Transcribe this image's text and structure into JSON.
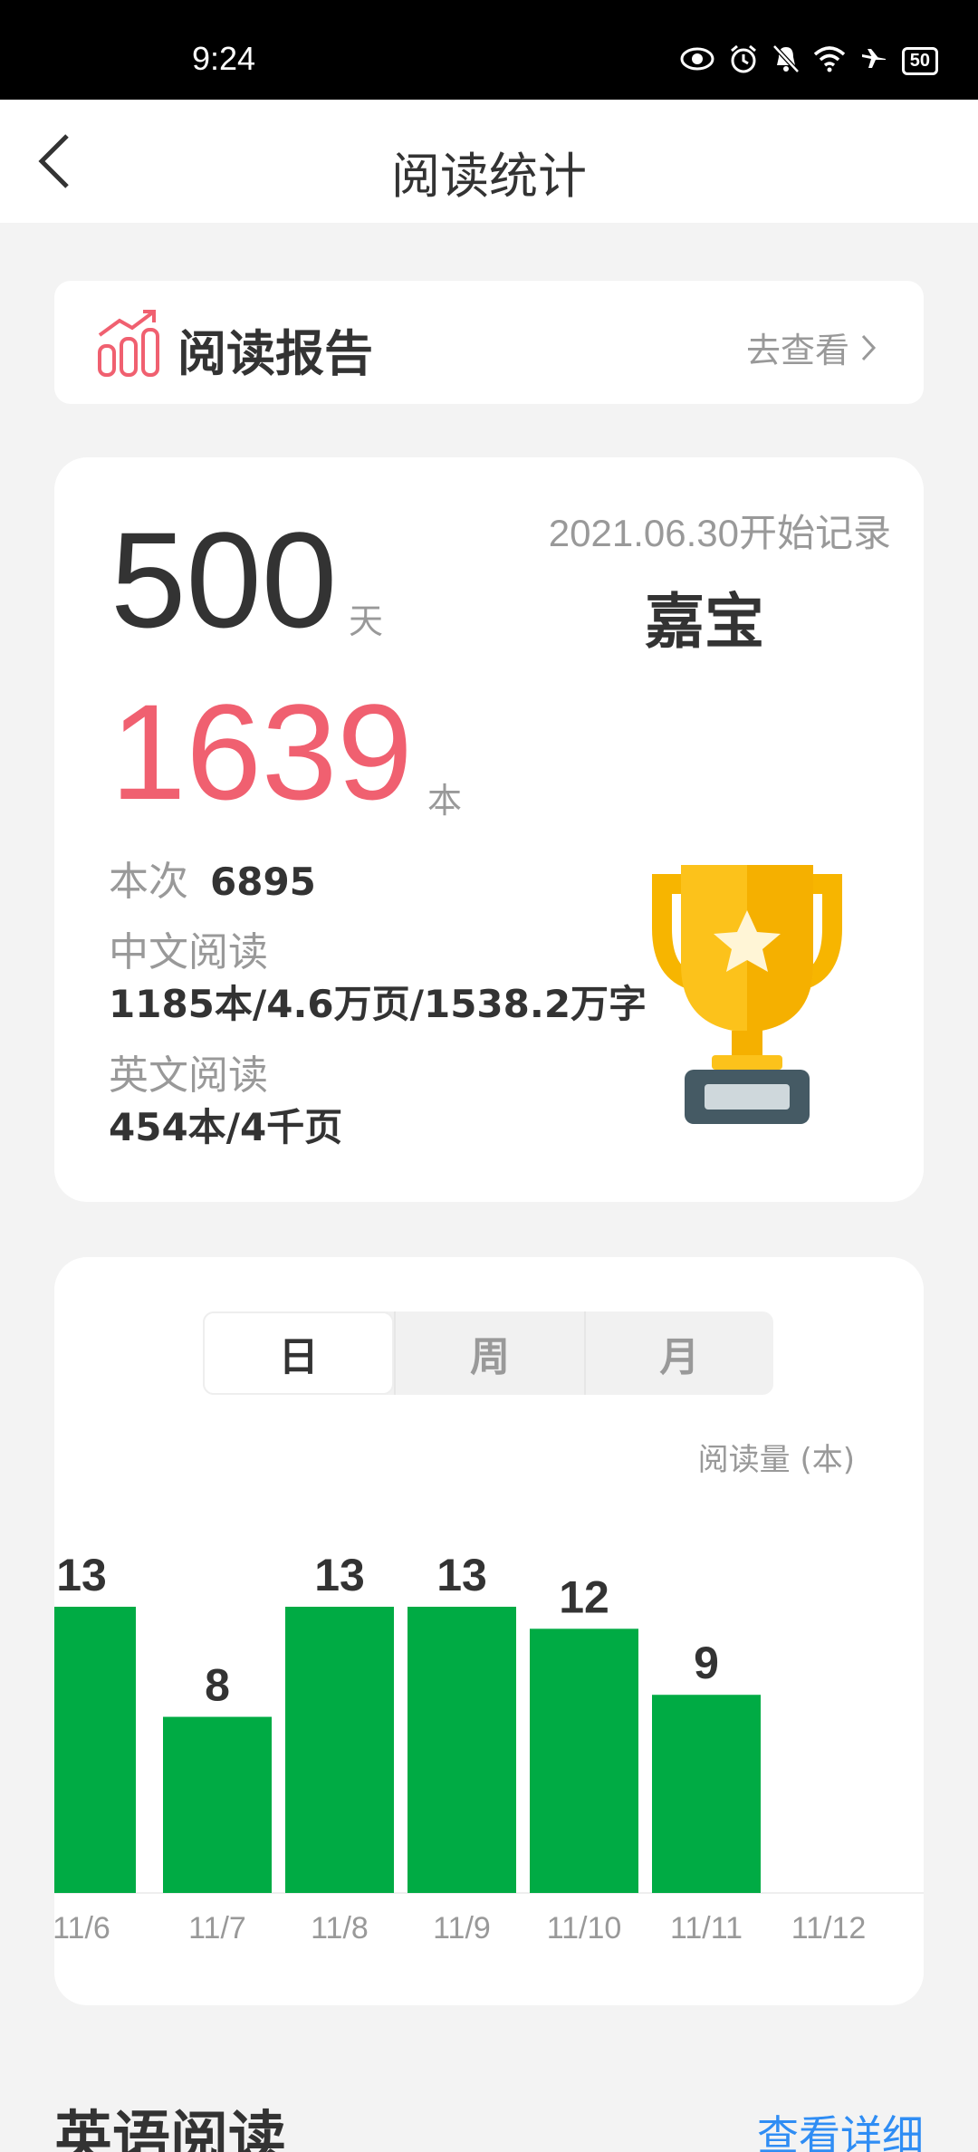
{
  "status": {
    "time": "9:24",
    "battery": "50"
  },
  "nav": {
    "title": "阅读统计"
  },
  "report": {
    "title": "阅读报告",
    "link": "去查看"
  },
  "summary": {
    "days": "500",
    "days_unit": "天",
    "start_date": "2021.06.30开始记录",
    "child_name": "嘉宝",
    "books": "1639",
    "books_unit": "本",
    "this_time_label": "本次",
    "this_time_value": "6895",
    "chinese_label": "中文阅读",
    "chinese_value": "1185本/4.6万页/1538.2万字",
    "english_label": "英文阅读",
    "english_value": "454本/4千页"
  },
  "tabs": [
    {
      "label": "日",
      "active": true
    },
    {
      "label": "周",
      "active": false
    },
    {
      "label": "月",
      "active": false
    }
  ],
  "chart_unit": "阅读量 (本)",
  "chart_data": {
    "type": "bar",
    "categories": [
      "11/6",
      "11/7",
      "11/8",
      "11/9",
      "11/10",
      "11/11",
      "11/12"
    ],
    "values": [
      13,
      8,
      13,
      13,
      12,
      9,
      null
    ],
    "ylabel": "阅读量 (本)",
    "color": "#00ab44"
  },
  "english_section": {
    "title": "英语阅读",
    "link": "查看详细"
  },
  "colors": {
    "accent_red": "#f06070",
    "bar_green": "#00ab44",
    "link_blue": "#2f8df4"
  }
}
